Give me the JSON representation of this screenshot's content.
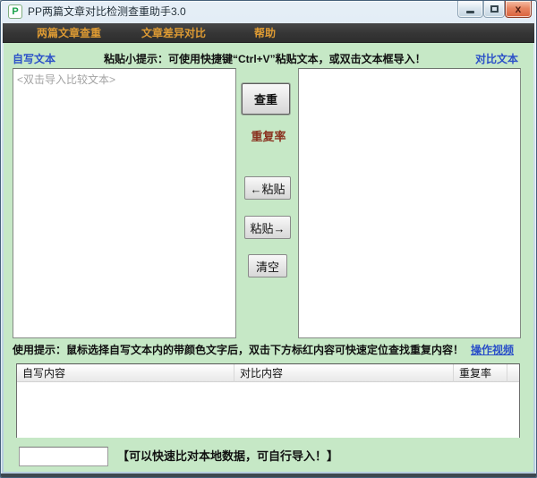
{
  "window": {
    "title": "PP两篇文章对比检测查重助手3.0"
  },
  "icons": {
    "app_logo": "P",
    "close": "x"
  },
  "menu": {
    "items": [
      {
        "label": "两篇文章查重"
      },
      {
        "label": "文章差异对比"
      },
      {
        "label": "帮助"
      }
    ]
  },
  "compare": {
    "left_label": "自写文本",
    "right_label": "对比文本",
    "paste_hint": "粘贴小提示：可使用快捷键“Ctrl+V”粘贴文本，或双击文本框导入！",
    "left_placeholder": "<双击导入比较文本>",
    "left_value": "",
    "right_value": "",
    "check_button": "查重",
    "repeat_rate_label": "重复率",
    "paste_left_button": "←粘贴",
    "paste_right_button": "粘贴→",
    "clear_button": "清空"
  },
  "usage": {
    "hint": "使用提示：鼠标选择自写文本内的带颜色文字后，双击下方标红内容可快速定位查找重复内容！",
    "video_link": "操作视频"
  },
  "results_table": {
    "columns": [
      "自写内容",
      "对比内容",
      "重复率"
    ],
    "rows": []
  },
  "footer": {
    "input_value": "",
    "note": "【可以快速比对本地数据，可自行导入！】"
  },
  "colors": {
    "client_green": "#c6e8c6",
    "menu_bg": "#353535",
    "menu_text": "#dd9a33",
    "label_blue": "#2b50c8",
    "rate_label_red": "#8a3220",
    "close_button": "#d9603a"
  }
}
